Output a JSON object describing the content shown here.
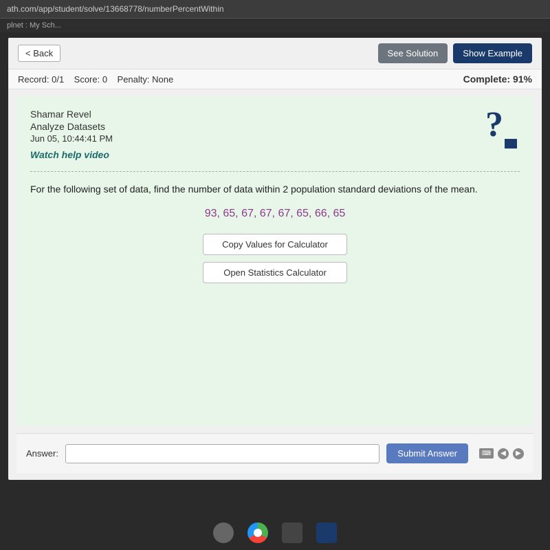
{
  "browser": {
    "url": "ath.com/app/student/solve/13668778/numberPercentWithin",
    "tab_label": "plnet : My Sch..."
  },
  "toolbar": {
    "back_label": "< Back",
    "see_solution_label": "See Solution",
    "show_example_label": "Show Example"
  },
  "status_bar": {
    "record_label": "Record: 0/1",
    "score_label": "Score: 0",
    "penalty_label": "Penalty: None",
    "complete_label": "Complete: 91%"
  },
  "problem": {
    "student_name": "Shamar Revel",
    "subject": "Analyze Datasets",
    "date_time": "Jun 05, 10:44:41 PM",
    "watch_help_label": "Watch help video",
    "divider": true,
    "problem_text": "For the following set of data, find the number of data within 2 population standard deviations of the mean.",
    "data_values": "93, 65, 67, 67, 67, 65, 66, 65",
    "copy_values_btn": "Copy Values for Calculator",
    "open_stats_btn": "Open Statistics Calculator"
  },
  "answer": {
    "answer_label": "Answer:",
    "answer_placeholder": "",
    "submit_label": "Submit Answer"
  }
}
